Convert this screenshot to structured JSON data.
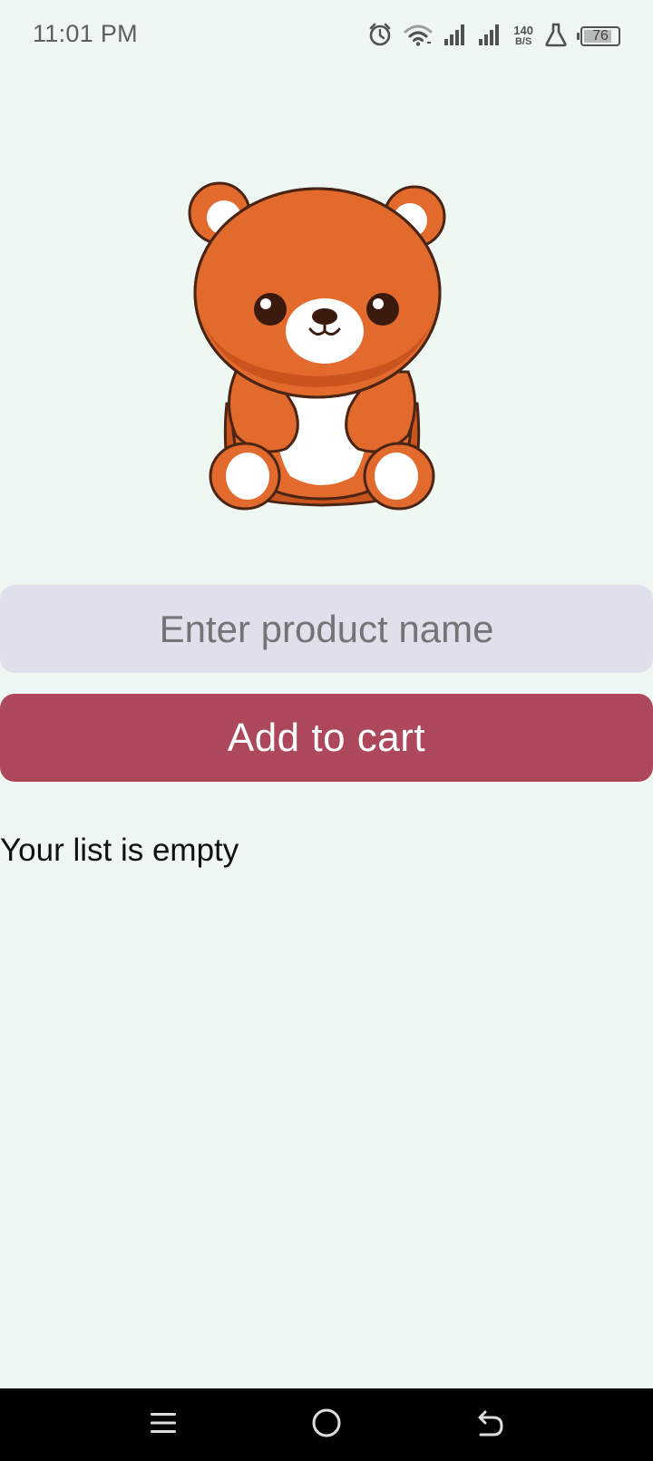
{
  "status_bar": {
    "time": "11:01 PM",
    "net_speed_value": "140",
    "net_speed_unit": "B/S",
    "battery_level": "76",
    "icons": [
      "alarm-icon",
      "wifi-icon",
      "signal-icon",
      "signal-icon",
      "lab-icon",
      "battery-icon"
    ]
  },
  "illustration": {
    "name": "teddy-bear",
    "colors": {
      "fur": "#e26a2c",
      "fur_shadow": "#c9541e",
      "outline": "#4a2414",
      "belly": "#ffffff"
    }
  },
  "form": {
    "product_input_placeholder": "Enter product name",
    "product_input_value": "",
    "add_button_label": "Add to cart"
  },
  "cart": {
    "empty_message": "Your list is empty"
  },
  "nav_bar": {
    "items": [
      "menu-icon",
      "home-icon",
      "back-icon"
    ]
  },
  "colors": {
    "background": "#eef7f1",
    "input_bg": "#dee0eb",
    "button_bg": "#ad475c",
    "button_text": "#ffffff",
    "nav_bg": "#000000"
  }
}
